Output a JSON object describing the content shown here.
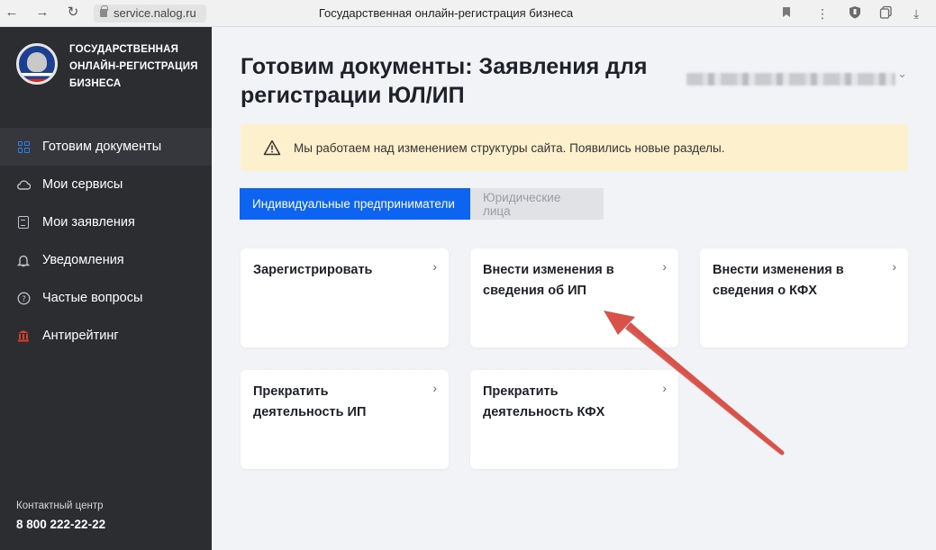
{
  "browser": {
    "url": "service.nalog.ru",
    "page_title": "Государственная онлайн-регистрация бизнеса",
    "icons": [
      "back-arrow",
      "forward-arrow",
      "reload",
      "lock",
      "bookmark",
      "menu-dots",
      "shield",
      "copy",
      "download"
    ]
  },
  "sidebar": {
    "brand_lines": [
      "ГОСУДАРСТВЕННАЯ",
      "ОНЛАЙН-РЕГИСТРАЦИЯ",
      "БИЗНЕСА"
    ],
    "items": [
      {
        "label": "Готовим документы",
        "icon": "grid-icon",
        "active": true
      },
      {
        "label": "Мои сервисы",
        "icon": "cloud-icon",
        "active": false
      },
      {
        "label": "Мои заявления",
        "icon": "document-icon",
        "active": false
      },
      {
        "label": "Уведомления",
        "icon": "bell-icon",
        "active": false
      },
      {
        "label": "Частые вопросы",
        "icon": "question-icon",
        "active": false
      },
      {
        "label": "Антирейтинг",
        "icon": "bank-icon",
        "active": false
      }
    ],
    "contact_label": "Контактный центр",
    "contact_phone": "8 800 222-22-22"
  },
  "main": {
    "title": "Готовим документы: Заявления для регистрации ЮЛ/ИП",
    "alert_text": "Мы работаем над изменением структуры сайта. Появились новые разделы.",
    "tabs": [
      {
        "label": "Индивидуальные предприниматели",
        "active": true
      },
      {
        "label": "Юридические лица",
        "active": false
      }
    ],
    "cards": [
      {
        "title": "Зарегистрировать"
      },
      {
        "title": "Внести изменения в сведения об ИП"
      },
      {
        "title": "Внести изменения в сведения о КФХ"
      },
      {
        "title": "Прекратить деятельность ИП"
      },
      {
        "title": "Прекратить деятельность КФХ"
      }
    ]
  },
  "colors": {
    "sidebar_bg": "#2b2d31",
    "accent_blue": "#0d64f0",
    "alert_bg": "#fdf0cc",
    "annotation_arrow": "#d8524a"
  }
}
